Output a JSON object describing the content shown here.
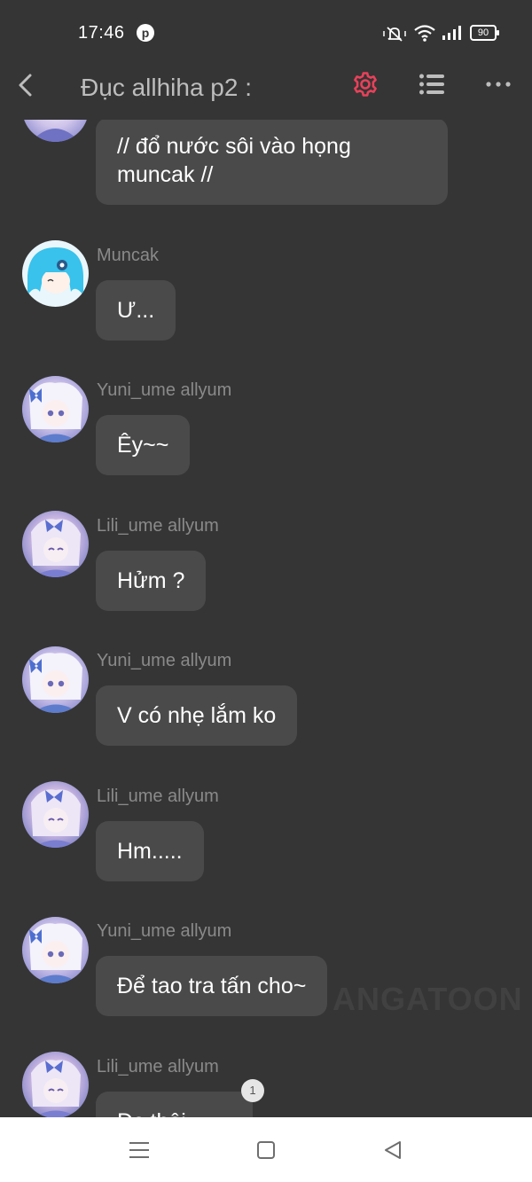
{
  "status_bar": {
    "time": "17:46",
    "app_icon": "pinterest-icon",
    "battery": "90"
  },
  "header": {
    "title": "Đục allhiha p2 :"
  },
  "icons": {
    "back": "back-arrow-icon",
    "settings": "gear-icon",
    "list": "list-icon",
    "more": "more-icon"
  },
  "colors": {
    "background": "#353535",
    "bubble": "#4a4a4a",
    "sender_name": "#8a8a8a",
    "settings_accent": "#e8415a"
  },
  "messages": [
    {
      "sender": "",
      "text": "// đổ nước sôi vào họng muncak //"
    },
    {
      "sender": "Muncak",
      "text": "Ư..."
    },
    {
      "sender": "Yuni_ume allyum",
      "text": "Êy~~"
    },
    {
      "sender": "Lili_ume allyum",
      "text": "Hửm ?"
    },
    {
      "sender": "Yuni_ume allyum",
      "text": "V có nhẹ lắm ko"
    },
    {
      "sender": "Lili_ume allyum",
      "text": "Hm....."
    },
    {
      "sender": "Yuni_ume allyum",
      "text": "Để tao tra tấn cho~"
    },
    {
      "sender": "Lili_ume allyum",
      "text": "Đc thôi",
      "badge": "1"
    }
  ],
  "watermark": "ANGATOON"
}
